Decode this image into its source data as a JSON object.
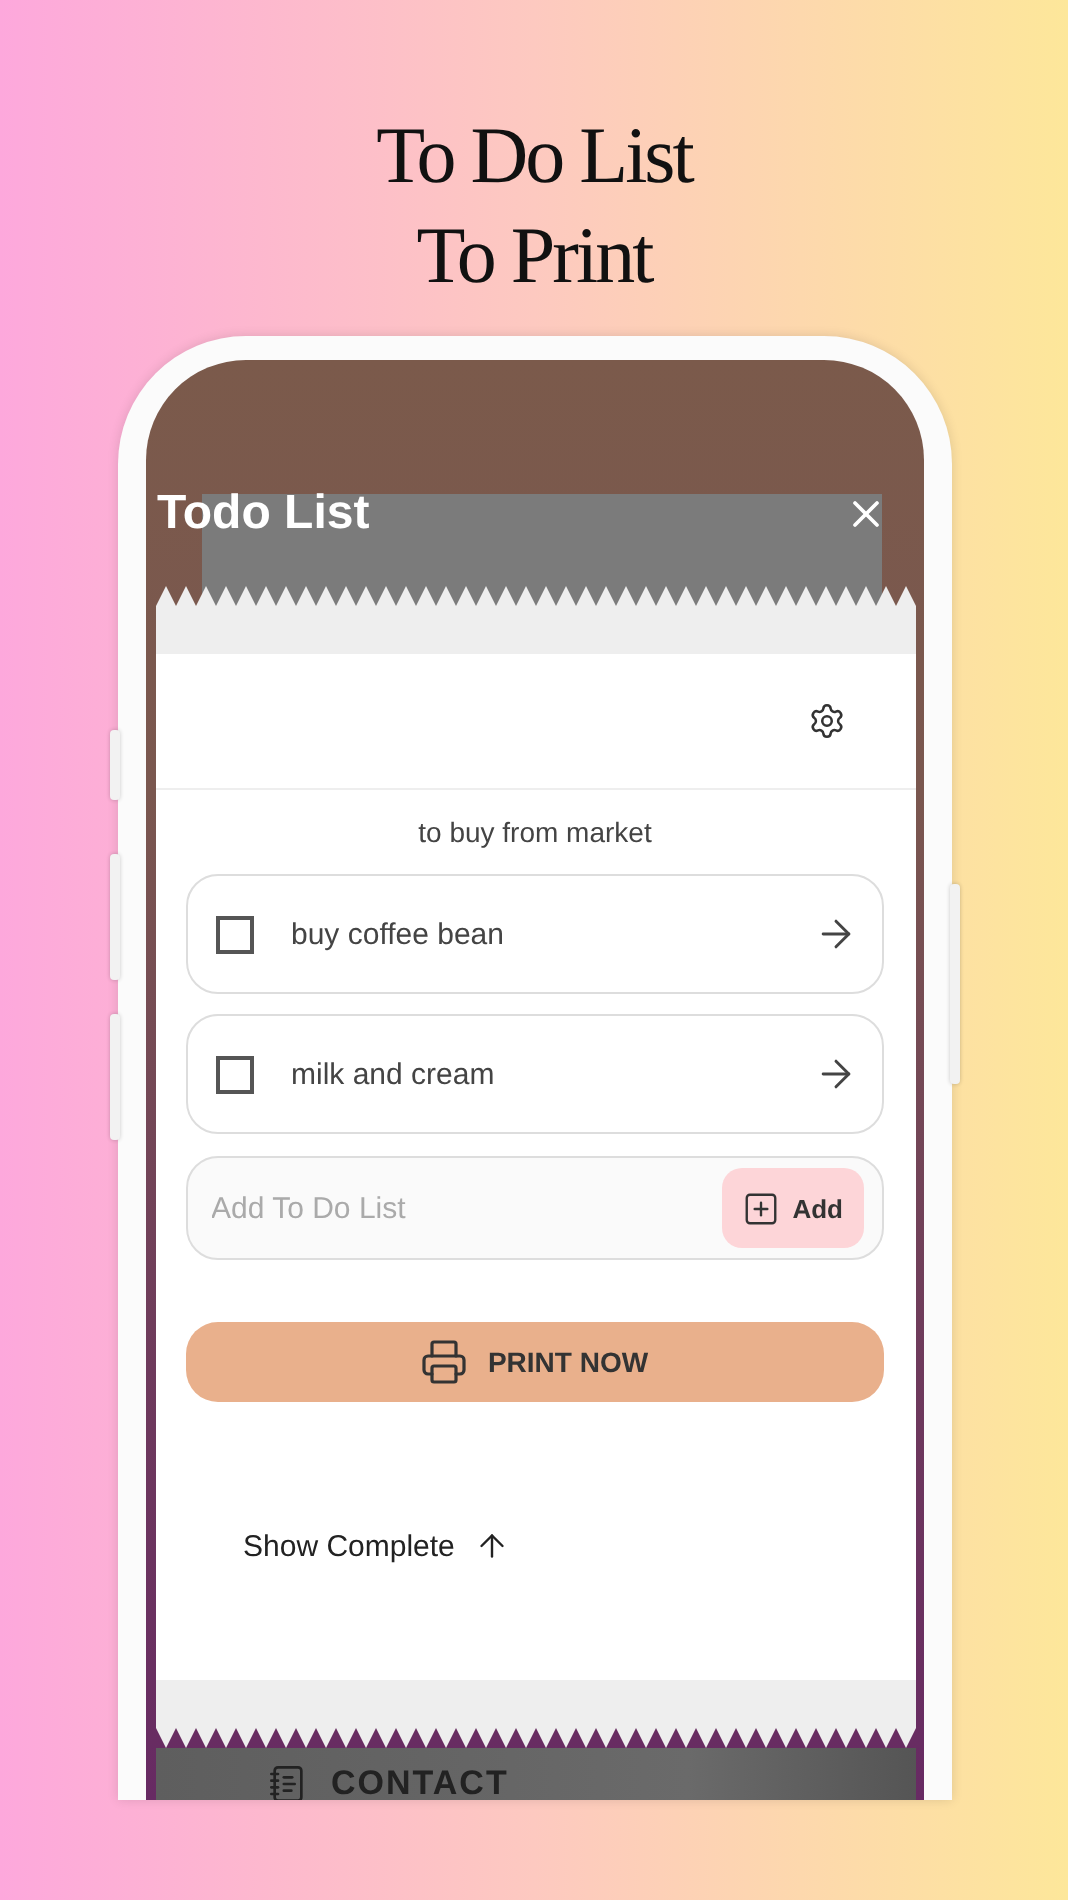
{
  "headline": [
    "To Do List",
    "To Print"
  ],
  "panel": {
    "title": "Todo List"
  },
  "list": {
    "name": "to buy from market",
    "items": [
      {
        "text": "buy coffee bean",
        "checked": false
      },
      {
        "text": "milk and cream",
        "checked": false
      }
    ]
  },
  "add_field": {
    "placeholder": "Add To Do List",
    "button": "Add"
  },
  "print_button": {
    "label": "PRINT NOW"
  },
  "show_complete": {
    "label": "Show Complete"
  },
  "footer_sheet": {
    "label": "CONTACT"
  }
}
